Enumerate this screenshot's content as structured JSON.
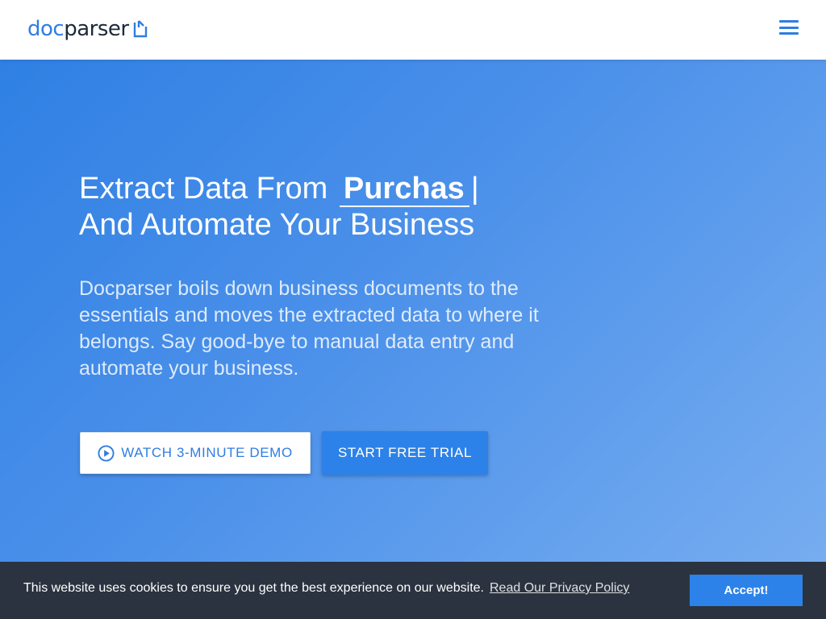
{
  "header": {
    "logo": {
      "part_a": "doc",
      "part_b": "parser",
      "mark_icon": "document-corner-icon"
    },
    "menu_icon": "hamburger-menu-icon"
  },
  "hero": {
    "headline_prefix": "Extract Data From",
    "headline_typed": "Purchas",
    "headline_cursor": "|",
    "headline_line2": "And Automate Your Business",
    "subtext": "Docparser boils down business documents to the essentials and moves the extracted data to where it belongs. Say good-bye to manual data entry and automate your business.",
    "demo_button_label": "WATCH 3-MINUTE DEMO",
    "demo_button_icon": "play-circle-icon",
    "trial_button_label": "START FREE TRIAL"
  },
  "cookie_bar": {
    "message": "This website uses cookies to ensure you get the best experience on our website.",
    "link_label": "Read Our Privacy Policy",
    "accept_label": "Accept!"
  },
  "colors": {
    "brand_blue": "#2f7de1",
    "dark_text": "#1c2a3a",
    "cookie_bg": "#2b3340",
    "button_blue": "#2c82e8"
  }
}
